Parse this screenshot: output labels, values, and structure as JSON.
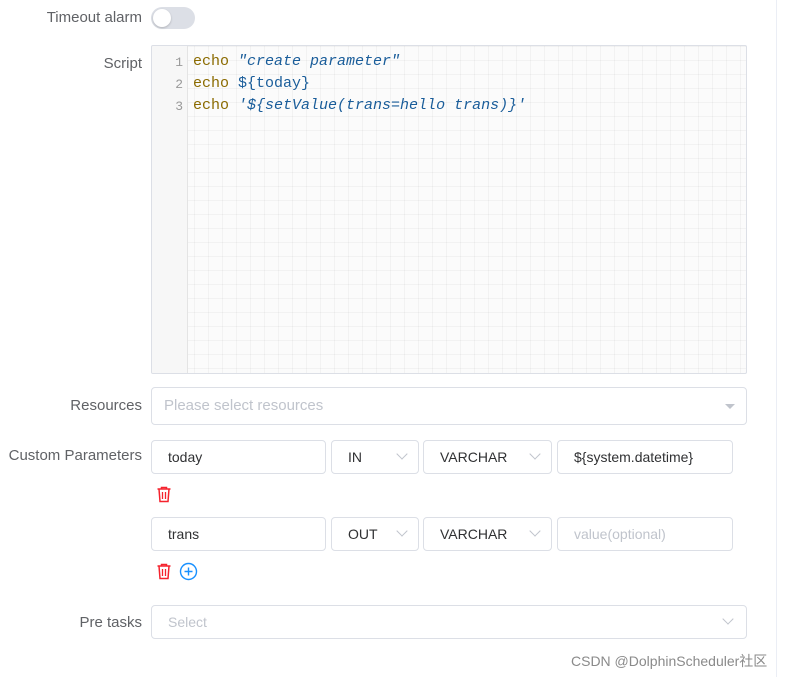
{
  "timeout_alarm": {
    "label": "Timeout alarm",
    "enabled": false
  },
  "script": {
    "label": "Script",
    "lines": [
      {
        "number": "1",
        "keyword": "echo",
        "arg": "\"create parameter\""
      },
      {
        "number": "2",
        "keyword": "echo",
        "arg": "${today}"
      },
      {
        "number": "3",
        "keyword": "echo",
        "arg": "'${setValue(trans=hello trans)}'"
      }
    ]
  },
  "resources": {
    "label": "Resources",
    "placeholder": "Please select resources"
  },
  "custom_parameters": {
    "label": "Custom Parameters",
    "rows": [
      {
        "prop": "today",
        "direct": "IN",
        "type": "VARCHAR",
        "value": "${system.datetime}",
        "value_placeholder": ""
      },
      {
        "prop": "trans",
        "direct": "OUT",
        "type": "VARCHAR",
        "value": "",
        "value_placeholder": "value(optional)"
      }
    ]
  },
  "pre_tasks": {
    "label": "Pre tasks",
    "placeholder": "Select"
  },
  "watermark": "CSDN @DolphinScheduler社区",
  "colors": {
    "delete": "#f5222d",
    "add": "#1890ff",
    "border": "#dcdfe6",
    "placeholder": "#c0c4cc"
  },
  "icons": {
    "delete": "trash-icon",
    "add": "plus-circle-icon",
    "select": "chevron-down-icon"
  }
}
